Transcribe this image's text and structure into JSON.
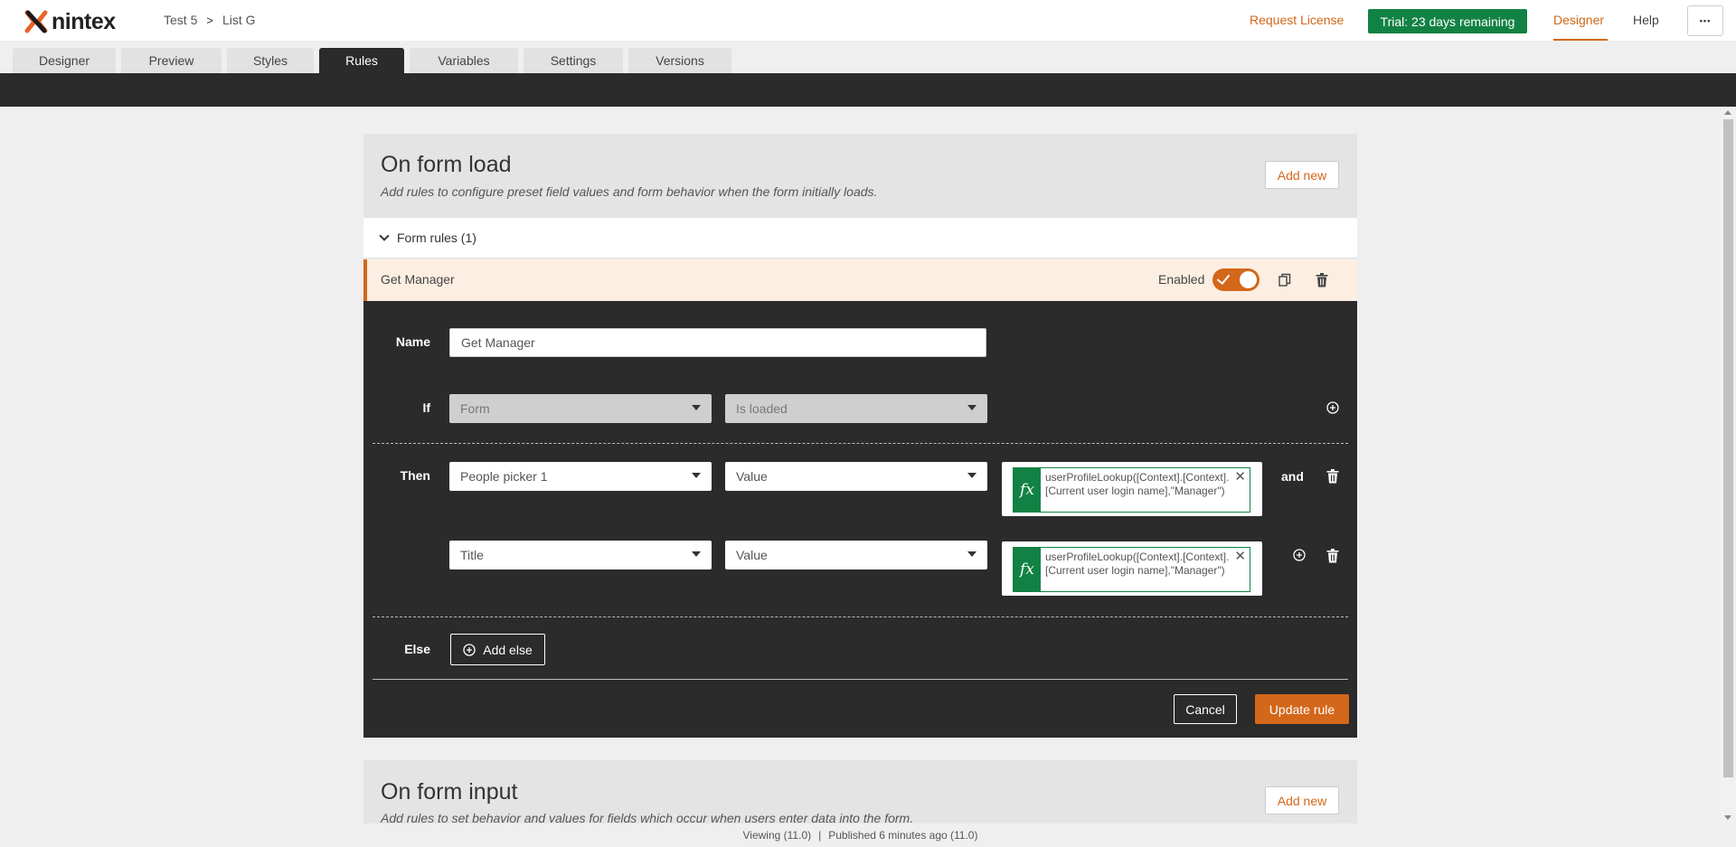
{
  "brand": {
    "logo_text": "nintex",
    "accent": "#d3671a",
    "green": "#128244"
  },
  "breadcrumb": {
    "workspace": "Test 5",
    "separator": ">",
    "list": "List G"
  },
  "header": {
    "request_license": "Request License",
    "trial": "Trial: 23 days remaining",
    "designer": "Designer",
    "help": "Help",
    "more": "•••"
  },
  "tabs": [
    {
      "label": "Designer"
    },
    {
      "label": "Preview"
    },
    {
      "label": "Styles"
    },
    {
      "label": "Rules",
      "active": true
    },
    {
      "label": "Variables"
    },
    {
      "label": "Settings"
    },
    {
      "label": "Versions"
    }
  ],
  "on_form_load": {
    "title": "On form load",
    "description": "Add rules to configure preset field values and form behavior when the form initially loads.",
    "add_new": "Add new",
    "rules_header": "Form rules (1)",
    "rule": {
      "name": "Get Manager",
      "enabled_label": "Enabled",
      "enabled": true
    }
  },
  "editor": {
    "name_label": "Name",
    "name_value": "Get Manager",
    "if_label": "If",
    "if_field": "Form",
    "if_condition": "Is loaded",
    "then_label": "Then",
    "actions": [
      {
        "field": "People picker 1",
        "property": "Value",
        "expression": "userProfileLookup([Context].[Context].[Current user login name],\"Manager\")"
      },
      {
        "field": "Title",
        "property": "Value",
        "expression": "userProfileLookup([Context].[Context].[Current user login name],\"Manager\")"
      }
    ],
    "and_label": "and",
    "fx_label": "fx",
    "else_label": "Else",
    "add_else": "Add else",
    "cancel": "Cancel",
    "update_rule": "Update rule"
  },
  "on_form_input": {
    "title": "On form input",
    "description": "Add rules to set behavior and values for fields which occur when users enter data into the form.",
    "add_new": "Add new"
  },
  "footer": {
    "viewing": "Viewing (11.0)",
    "separator": "|",
    "published": "Published 6 minutes ago (11.0)"
  }
}
